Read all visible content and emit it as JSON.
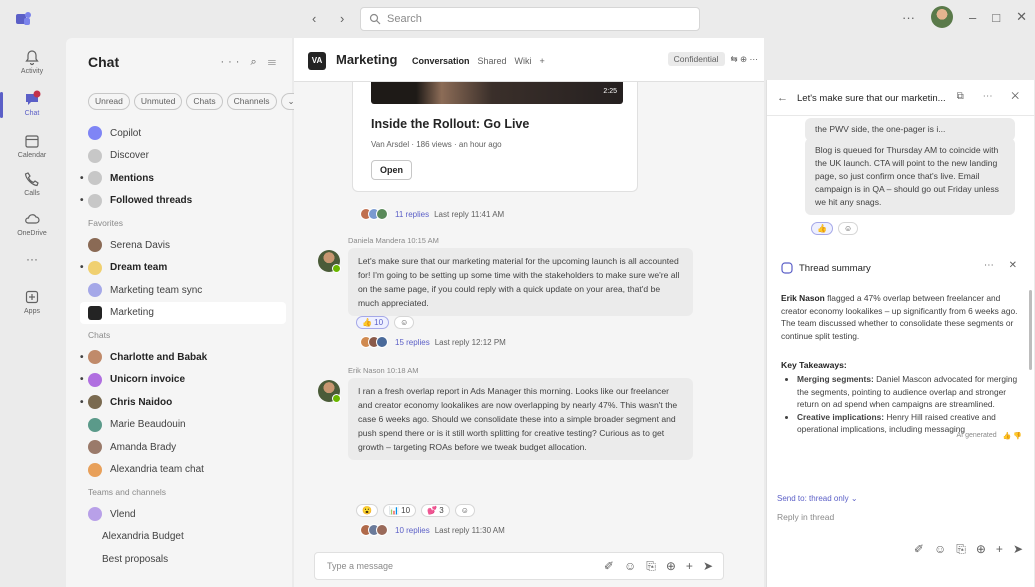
{
  "titlebar": {
    "search_placeholder": "Search",
    "nav": "‹  ›",
    "controls": [
      "···",
      "–",
      "□",
      "✕"
    ]
  },
  "rail": [
    {
      "label": "Activity",
      "icon": "bell-icon"
    },
    {
      "label": "Chat",
      "icon": "chat-icon",
      "active": true
    },
    {
      "label": "Calendar",
      "icon": "calendar-icon"
    },
    {
      "label": "Calls",
      "icon": "phone-icon"
    },
    {
      "label": "OneDrive",
      "icon": "cloud-icon"
    },
    {
      "label": "···",
      "icon": "more-icon"
    },
    {
      "label": "Apps",
      "icon": "apps-icon"
    }
  ],
  "chatlist": {
    "title": "Chat",
    "tools": "··· ⌕ ☰",
    "filters": [
      "Unread",
      "Unmuted",
      "Chats",
      "Channels",
      "⌄"
    ],
    "top_items": [
      {
        "label": "Copilot",
        "color": "#7f85f5"
      },
      {
        "label": "Discover",
        "color": "#c7c7c7"
      },
      {
        "label": "Mentions",
        "color": "#c7c7c7",
        "bold": true,
        "dot": true
      },
      {
        "label": "Followed threads",
        "color": "#c7c7c7",
        "bold": true,
        "dot": true
      }
    ],
    "favorites_label": "Favorites",
    "favorites": [
      {
        "label": "Serena Davis",
        "color": "#8a6a55"
      },
      {
        "label": "Dream team",
        "color": "#f0d070",
        "bold": true,
        "dot": true
      },
      {
        "label": "Marketing team sync",
        "color": "#a5a8e8"
      },
      {
        "label": "Marketing",
        "color": "#242424",
        "selected": true
      }
    ],
    "chats_label": "Chats",
    "chats": [
      {
        "label": "Charlotte and Babak",
        "color": "#c08a6a",
        "bold": true,
        "dot": true
      },
      {
        "label": "Unicorn invoice",
        "color": "#b06fe0",
        "bold": true,
        "dot": true
      },
      {
        "label": "Chris Naidoo",
        "color": "#7a6a50",
        "bold": true,
        "dot": true
      },
      {
        "label": "Marie Beaudouin",
        "color": "#5b9a8a"
      },
      {
        "label": "Amanda Brady",
        "color": "#9a7a6a"
      },
      {
        "label": "Alexandria team chat",
        "color": "#e8a05a"
      }
    ],
    "teams_label": "Teams and channels",
    "teams": [
      {
        "label": "Vlend",
        "color": "#b8a0e8"
      },
      {
        "label": "Alexandria Budget",
        "color": ""
      },
      {
        "label": "Best proposals",
        "color": ""
      }
    ]
  },
  "channel": {
    "logo": "VA",
    "name": "Marketing",
    "tabs": [
      "Conversation",
      "Shared",
      "Wiki",
      "+"
    ],
    "confidential": "Confidential",
    "right_icons": "⇆ ⊕ ⋯"
  },
  "card": {
    "duration": "2:25",
    "title": "Inside the Rollout: Go Live",
    "meta": "Van Arsdel · 186 views · an hour ago",
    "button": "Open"
  },
  "reply1": {
    "replies": "11 replies",
    "last": "Last reply 11:41 AM"
  },
  "msg1": {
    "meta": "Daniela Mandera  10:15 AM",
    "text": "Let's make sure that our marketing material for the upcoming launch is all accounted for! I'm going to be setting up some time with the stakeholders to make sure we're all on the same page, if you could reply with a quick update on your area, that'd be much appreciated.",
    "reactions": [
      {
        "label": "👍 10",
        "hl": true
      },
      {
        "label": "☺",
        "hl": false
      }
    ],
    "replies": "15 replies",
    "last": "Last reply 12:12 PM"
  },
  "msg2": {
    "meta": "Erik Nason  10:18 AM",
    "text": "I ran a fresh overlap report in Ads Manager this morning. Looks like our freelancer and creator economy lookalikes are now overlapping by nearly 47%. This wasn't the case 6 weeks ago. Should we consolidate these into a simple broader segment and push spend there or is it still worth splitting for creative testing? Curious as to get growth – targeting ROAs before we tweak budget allocation.",
    "reactions": [
      {
        "label": "😮",
        "hl": false
      },
      {
        "label": "📊 10",
        "hl": false
      },
      {
        "label": "💕 3",
        "hl": false
      },
      {
        "label": "☺",
        "hl": false
      }
    ],
    "replies": "10 replies",
    "last": "Last reply 11:30 AM"
  },
  "composer": {
    "placeholder": "Type a message",
    "tools": [
      "✐",
      "☺",
      "⎘",
      "⊕",
      "+",
      "➤"
    ]
  },
  "thread": {
    "title": "Let's make sure that our marketin...",
    "tools": "⧉ ⋯ ✕",
    "bubble1": "the PWV side, the one-pager is i...",
    "bubble2": "Blog is queued for Thursday AM to coincide with the UK launch. CTA will point to the new landing page, so just confirm once that's live. Email campaign is in QA – should go out Friday unless we hit any snags.",
    "reactions": [
      {
        "label": "👍",
        "hl": true
      },
      {
        "label": "☺",
        "hl": false
      }
    ],
    "summary_title": "Thread summary",
    "summary_tools": "⋯ ✕",
    "summary_name": "Erik Nason",
    "summary_text": " flagged a 47% overlap between freelancer and creator economy lookalikes – up significantly from 6 weeks ago. The team discussed whether to consolidate these segments or continue split testing.",
    "key_title": "Key Takeaways:",
    "key_items": [
      {
        "head": "Merging segments:",
        "text": " Daniel Mascon advocated for merging the segments, pointing to audience overlap and stronger return on ad spend when campaigns are streamlined."
      },
      {
        "head": "Creative implications:",
        "text": " Henry Hill raised creative and operational implications, including messaging"
      }
    ],
    "ai_note": "AI generated",
    "feedback": "👍 👎",
    "send_to": "Send to: thread only ⌄",
    "reply_placeholder": "Reply in thread",
    "reply_tools": [
      "✐",
      "☺",
      "⎘",
      "⊕",
      "+",
      "➤"
    ]
  }
}
